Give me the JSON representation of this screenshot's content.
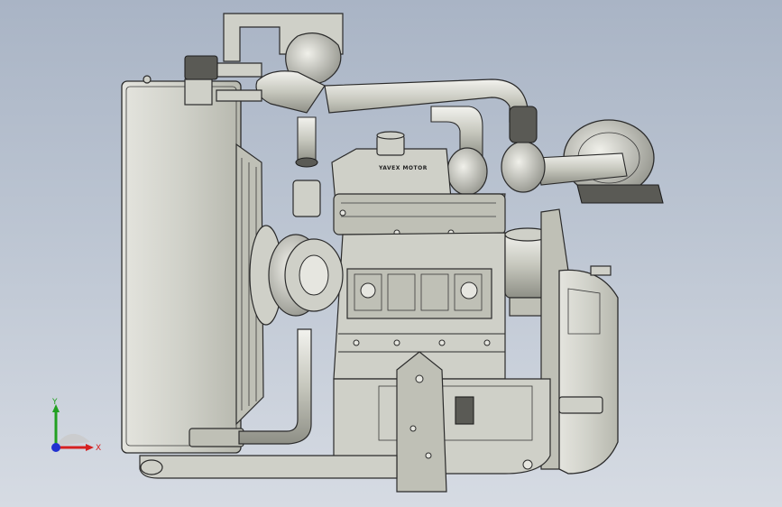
{
  "model": {
    "brand_label": "YAVEX MOTOR"
  },
  "triad": {
    "x_label": "X",
    "y_label": "Y",
    "colors": {
      "x": "#d62020",
      "y": "#21a021",
      "z": "#2030d0"
    }
  }
}
